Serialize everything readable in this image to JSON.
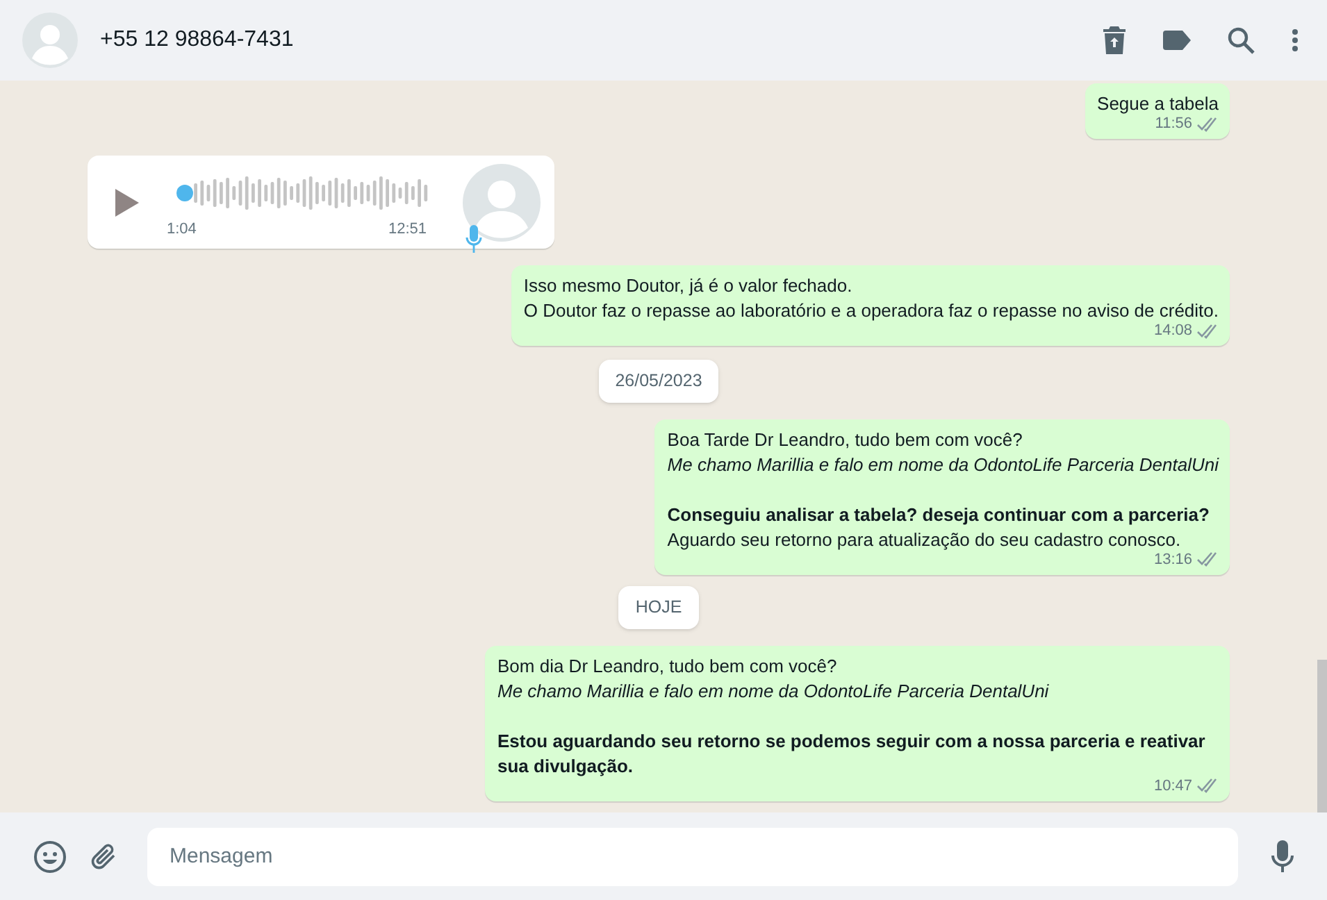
{
  "header": {
    "contact": "+55 12 98864-7431"
  },
  "messages": [
    {
      "kind": "text",
      "outgoing": true,
      "text": "Segue a tabela",
      "time": "11:56"
    },
    {
      "kind": "audio",
      "outgoing": false,
      "duration": "1:04",
      "time": "12:51",
      "level": 0.0
    },
    {
      "kind": "text",
      "outgoing": true,
      "text": "Isso mesmo Doutor, já é o valor fechado.\nO Doutor faz o repasse ao laboratório e a operadora faz o repasse no aviso de crédito.",
      "time": "14:08"
    },
    {
      "kind": "date",
      "label": "26/05/2023"
    },
    {
      "kind": "text",
      "outgoing": true,
      "text": "Boa Tarde Dr Leandro, tudo bem com você?\n*Me chamo Marillia e falo em nome da OdontoLife Parceria DentalUni*\n\n**Conseguiu analisar a tabela? deseja continuar com a parceria?**\nAguardo seu retorno para atualização do seu cadastro conosco.",
      "time": "13:16"
    },
    {
      "kind": "date",
      "label": "HOJE"
    },
    {
      "kind": "text",
      "outgoing": true,
      "text": "Bom dia Dr Leandro, tudo bem com você?\n*Me chamo Marillia e falo em nome da OdontoLife Parceria DentalUni*\n\n**Estou aguardando seu retorno se podemos seguir com a nossa parceria e reativar sua divulgação.**",
      "time": "10:47"
    }
  ],
  "composer": {
    "placeholder": "Mensagem"
  }
}
